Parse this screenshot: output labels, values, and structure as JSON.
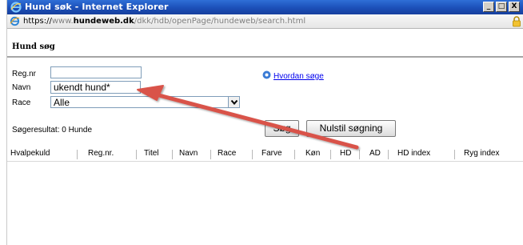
{
  "window": {
    "title": "Hund søk - Internet Explorer",
    "controls": {
      "minimize": "_",
      "maximize": "□",
      "close": "X"
    }
  },
  "address": {
    "protocol": "https://",
    "domain_prefix": "www.",
    "domain": "hundeweb.dk",
    "path": "/dkk/hdb/openPage/hundeweb/search.html"
  },
  "page": {
    "title": "Hund søg"
  },
  "form": {
    "regnr_label": "Reg.nr",
    "regnr_value": "",
    "navn_label": "Navn",
    "navn_value": "ukendt hund*",
    "race_label": "Race",
    "race_value": "Alle",
    "help_link": "Hvordan søge"
  },
  "results": {
    "summary": "Søgeresultat: 0 Hunde",
    "search_button": "Søg",
    "reset_button": "Nulstil søgning"
  },
  "table": {
    "columns": [
      "Hvalpekuld",
      "Reg.nr.",
      "Titel",
      "Navn",
      "Race",
      "Farve",
      "Køn",
      "HD",
      "AD",
      "HD index",
      "Ryg index"
    ]
  },
  "annotation": {
    "arrow_color": "#d9534a"
  },
  "colors": {
    "titlebar": "#1c4fb8",
    "link": "#0000ee"
  }
}
